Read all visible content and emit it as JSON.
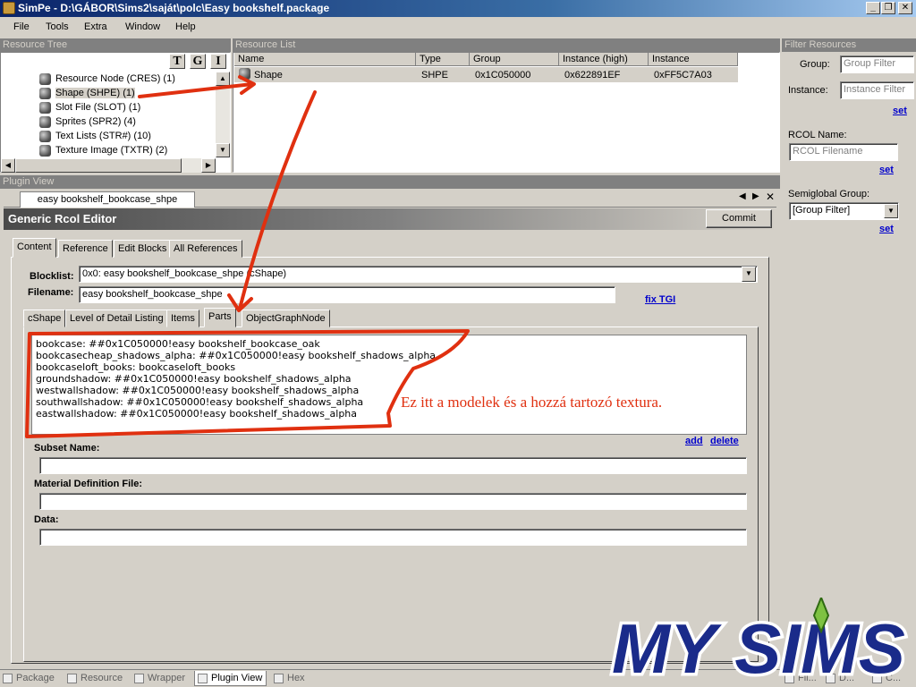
{
  "window": {
    "title": "SimPe - D:\\GÁBOR\\Sims2\\saját\\polc\\Easy bookshelf.package",
    "minimize": "_",
    "restore": "❐",
    "close": "✕"
  },
  "menu": [
    "File",
    "Tools",
    "Extra",
    "Window",
    "Help"
  ],
  "resource_tree": {
    "header": "Resource Tree",
    "buttons": [
      "T",
      "G",
      "I"
    ],
    "items": [
      {
        "label": "Resource Node (CRES) (1)"
      },
      {
        "label": "Shape (SHPE) (1)"
      },
      {
        "label": "Slot File (SLOT) (1)"
      },
      {
        "label": "Sprites (SPR2) (4)"
      },
      {
        "label": "Text Lists (STR#) (10)"
      },
      {
        "label": "Texture Image (TXTR) (2)"
      }
    ]
  },
  "resource_list": {
    "header": "Resource List",
    "columns": [
      "Name",
      "Type",
      "Group",
      "Instance (high)",
      "Instance"
    ],
    "rows": [
      [
        "Shape",
        "SHPE",
        "0x1C050000",
        "0x622891EF",
        "0xFF5C7A03"
      ]
    ]
  },
  "filter": {
    "header": "Filter Resources",
    "group_label": "Group:",
    "group_placeholder": "Group Filter",
    "instance_label": "Instance:",
    "instance_placeholder": "Instance Filter",
    "set_label": "set",
    "rcol_label": "RCOL Name:",
    "rcol_placeholder": "RCOL Filename",
    "semiglobal_label": "Semiglobal Group:",
    "semiglobal_value": "[Group Filter]"
  },
  "plugin_view": {
    "header": "Plugin View",
    "doc_tab": "easy bookshelf_bookcase_shpe",
    "editor_title": "Generic Rcol Editor",
    "commit": "Commit",
    "tabs": [
      "Content",
      "Reference",
      "Edit Blocks",
      "All References"
    ],
    "blocklist_label": "Blocklist:",
    "blocklist_value": "0x0: easy bookshelf_bookcase_shpe (cShape)",
    "filename_label": "Filename:",
    "filename_value": "easy bookshelf_bookcase_shpe",
    "fix_tgi": "fix TGI",
    "inner_tabs": [
      "cShape",
      "Level of Detail Listing",
      "Items",
      "Parts",
      "ObjectGraphNode"
    ],
    "parts": [
      "bookcase: ##0x1C050000!easy bookshelf_bookcase_oak",
      "bookcasecheap_shadows_alpha: ##0x1C050000!easy bookshelf_shadows_alpha",
      "bookcaseloft_books: bookcaseloft_books",
      "groundshadow: ##0x1C050000!easy bookshelf_shadows_alpha",
      "westwallshadow: ##0x1C050000!easy bookshelf_shadows_alpha",
      "southwallshadow: ##0x1C050000!easy bookshelf_shadows_alpha",
      "eastwallshadow: ##0x1C050000!easy bookshelf_shadows_alpha"
    ],
    "annotation": "Ez itt a modelek és a hozzá tartozó textura.",
    "add": "add",
    "delete": "delete",
    "subset_label": "Subset Name:",
    "material_label": "Material Definition File:",
    "data_label": "Data:"
  },
  "bottom_tabs": [
    "Package",
    "Resource",
    "Wrapper",
    "Plugin View",
    "Hex"
  ],
  "bottom_right_tabs": [
    "Fil...",
    "D...",
    "C..."
  ],
  "logo": {
    "text": "MySims"
  },
  "colors": {
    "annotation_red": "#e03010",
    "title_blue": "#0a246a"
  }
}
